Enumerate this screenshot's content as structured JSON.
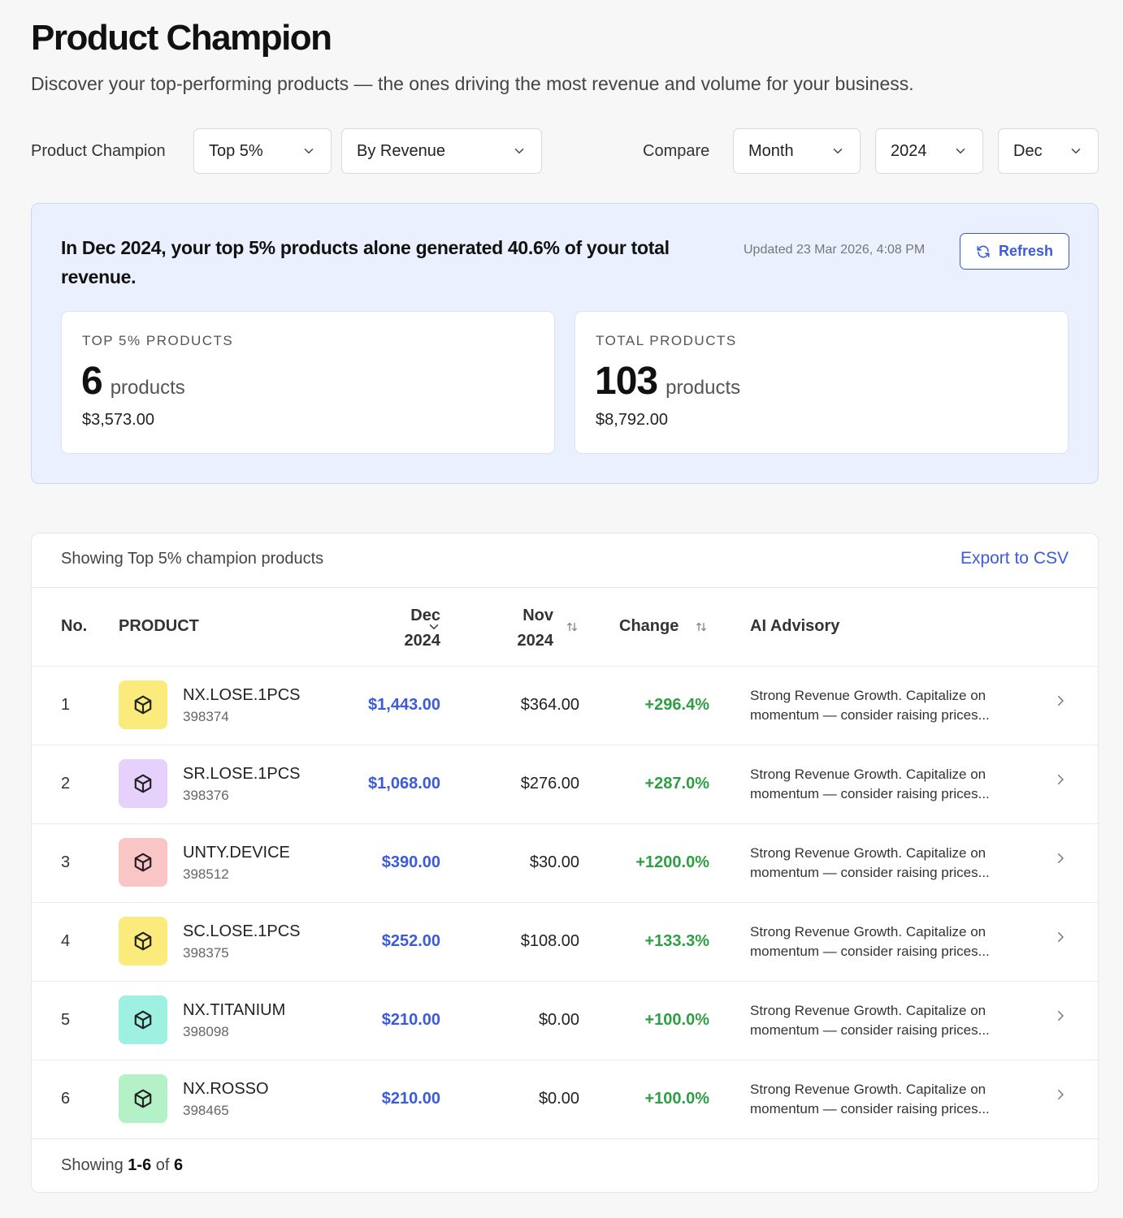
{
  "header": {
    "title": "Product Champion",
    "subtitle": "Discover your top-performing products — the ones driving the most revenue and volume for your business."
  },
  "filters": {
    "champion_label": "Product Champion",
    "champion_percent": "Top 5%",
    "champion_metric": "By Revenue",
    "compare_label": "Compare",
    "period": "Month",
    "year": "2024",
    "month": "Dec"
  },
  "summary": {
    "headline": "In Dec 2024, your top 5% products alone generated 40.6% of your total revenue.",
    "updated": "Updated 23 Mar 2026, 4:08 PM",
    "refresh_label": "Refresh",
    "top_card": {
      "label": "TOP 5% PRODUCTS",
      "count": "6",
      "unit": "products",
      "amount": "$3,573.00"
    },
    "total_card": {
      "label": "TOTAL PRODUCTS",
      "count": "103",
      "unit": "products",
      "amount": "$8,792.00"
    }
  },
  "table": {
    "caption": "Showing Top 5% champion products",
    "export_label": "Export to CSV",
    "columns": {
      "no": "No.",
      "product": "PRODUCT",
      "dec_month": "Dec",
      "dec_year": "2024",
      "nov_month": "Nov",
      "nov_year": "2024",
      "change": "Change",
      "advisory": "AI Advisory"
    },
    "rows": [
      {
        "no": "1",
        "name": "NX.LOSE.1PCS",
        "code": "398374",
        "dec": "$1,443.00",
        "nov": "$364.00",
        "change": "+296.4%",
        "advisory": "Strong Revenue Growth. Capitalize on momentum — consider raising prices...",
        "icon_color": "#fbeb7c"
      },
      {
        "no": "2",
        "name": "SR.LOSE.1PCS",
        "code": "398376",
        "dec": "$1,068.00",
        "nov": "$276.00",
        "change": "+287.0%",
        "advisory": "Strong Revenue Growth. Capitalize on momentum — consider raising prices...",
        "icon_color": "#e5d1fb"
      },
      {
        "no": "3",
        "name": "UNTY.DEVICE",
        "code": "398512",
        "dec": "$390.00",
        "nov": "$30.00",
        "change": "+1200.0%",
        "advisory": "Strong Revenue Growth. Capitalize on momentum — consider raising prices...",
        "icon_color": "#f9c5c5"
      },
      {
        "no": "4",
        "name": "SC.LOSE.1PCS",
        "code": "398375",
        "dec": "$252.00",
        "nov": "$108.00",
        "change": "+133.3%",
        "advisory": "Strong Revenue Growth. Capitalize on momentum — consider raising prices...",
        "icon_color": "#fbeb7c"
      },
      {
        "no": "5",
        "name": "NX.TITANIUM",
        "code": "398098",
        "dec": "$210.00",
        "nov": "$0.00",
        "change": "+100.0%",
        "advisory": "Strong Revenue Growth. Capitalize on momentum — consider raising prices...",
        "icon_color": "#9ef0e0"
      },
      {
        "no": "6",
        "name": "NX.ROSSO",
        "code": "398465",
        "dec": "$210.00",
        "nov": "$0.00",
        "change": "+100.0%",
        "advisory": "Strong Revenue Growth. Capitalize on momentum — consider raising prices...",
        "icon_color": "#b5f1c7"
      }
    ],
    "footer": {
      "prefix": "Showing",
      "range": "1-6",
      "of": "of",
      "total": "6"
    }
  },
  "colors": {
    "accent": "#3b5bdb",
    "positive": "#2f9e44",
    "summary_bg": "#eaf0fd"
  },
  "icons": {
    "select": "chevron-down-icon",
    "refresh": "refresh-icon",
    "sort": "sort-arrows-icon",
    "product": "package-cube-icon",
    "row_action": "chevron-right-icon"
  }
}
